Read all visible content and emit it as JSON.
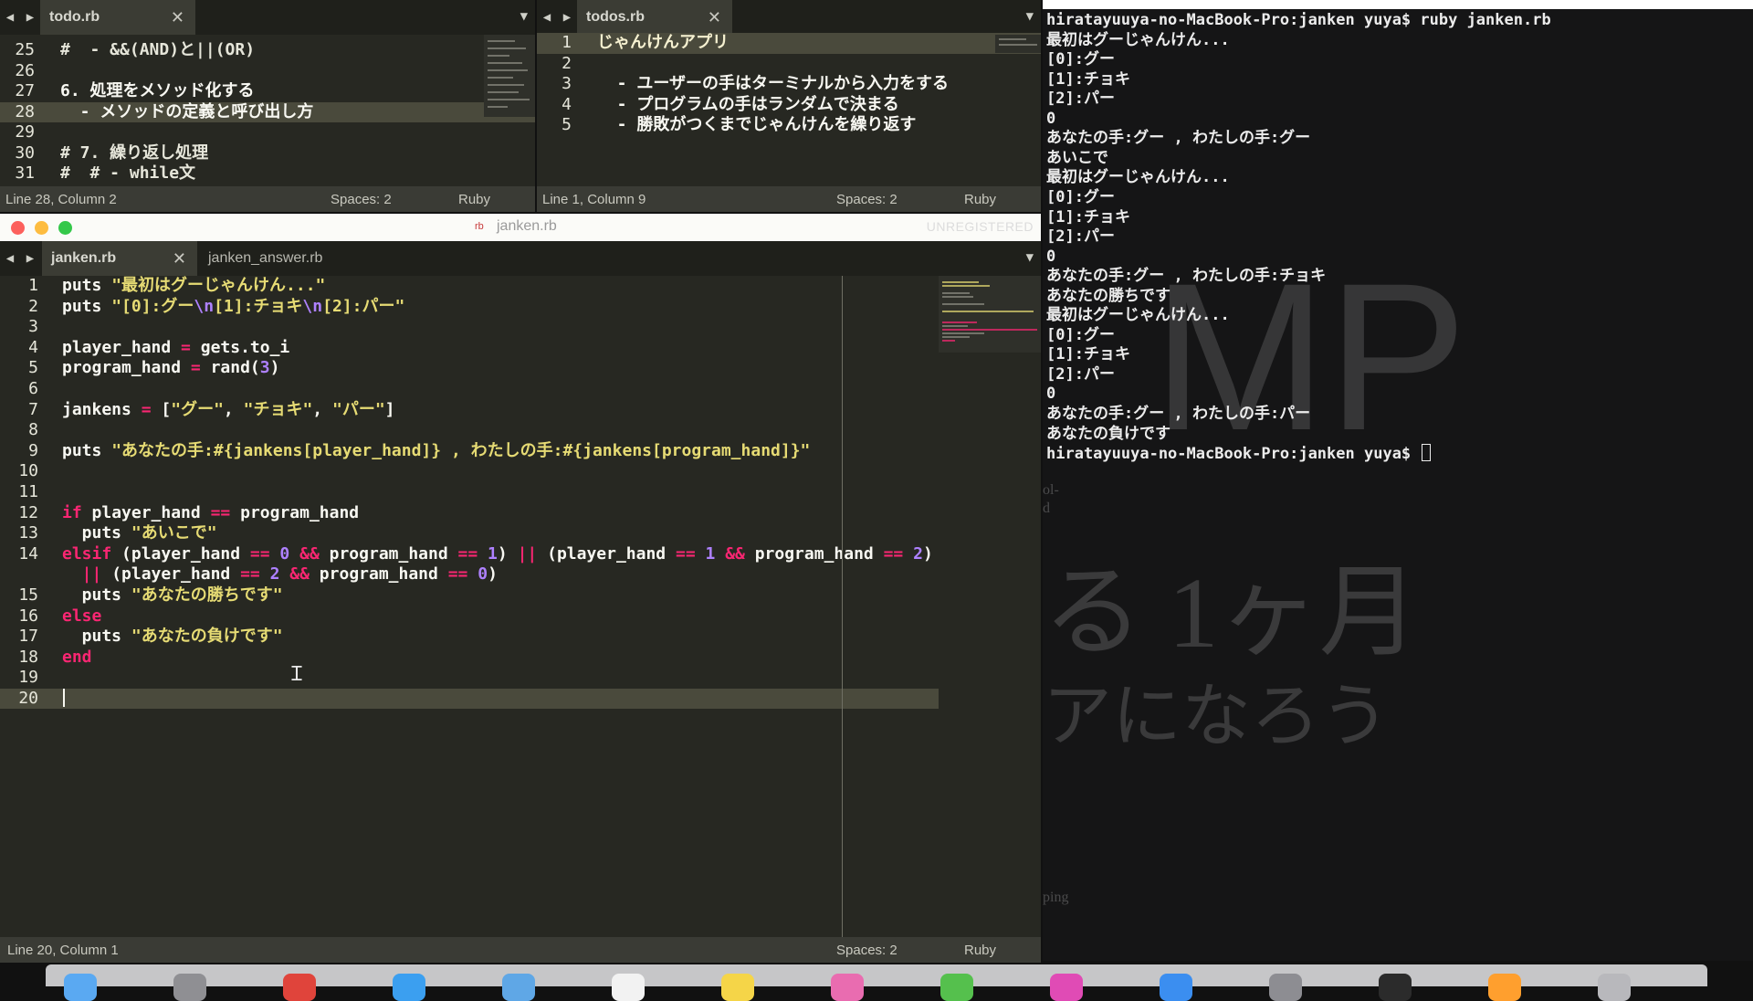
{
  "todo_pane": {
    "tab": "todo.rb",
    "status_pos": "Line 28, Column 2",
    "status_spaces": "Spaces: 2",
    "status_lang": "Ruby",
    "lines": [
      {
        "n": "25",
        "text": "#  - &&(AND)と||(OR)"
      },
      {
        "n": "26",
        "text": ""
      },
      {
        "n": "27",
        "text": "6. 処理をメソッド化する"
      },
      {
        "n": "28",
        "text": "  - メソッドの定義と呼び出し方"
      },
      {
        "n": "29",
        "text": ""
      },
      {
        "n": "30",
        "text": "# 7. 繰り返し処理"
      },
      {
        "n": "31",
        "text": "#  # - while文"
      }
    ]
  },
  "todos_pane": {
    "tab": "todos.rb",
    "status_pos": "Line 1, Column 9",
    "status_spaces": "Spaces: 2",
    "status_lang": "Ruby",
    "lines": [
      {
        "n": "1",
        "text": "じゃんけんアプリ"
      },
      {
        "n": "2",
        "text": ""
      },
      {
        "n": "3",
        "text": "  - ユーザーの手はターミナルから入力をする"
      },
      {
        "n": "4",
        "text": "  - プログラムの手はランダムで決まる"
      },
      {
        "n": "5",
        "text": "  - 勝敗がつくまでじゃんけんを繰り返す"
      }
    ]
  },
  "janken_window": {
    "title": "janken.rb",
    "unregistered": "UNREGISTERED",
    "tab_active": "janken.rb",
    "tab_other": "janken_answer.rb",
    "status_pos": "Line 20, Column 1",
    "status_spaces": "Spaces: 2",
    "status_lang": "Ruby",
    "line_numbers": [
      "1",
      "2",
      "3",
      "4",
      "5",
      "6",
      "7",
      "8",
      "9",
      "10",
      "11",
      "12",
      "13",
      "14",
      "",
      "15",
      "16",
      "17",
      "18",
      "19",
      "20"
    ],
    "code": {
      "l1_kw": "puts ",
      "l1_str": "\"最初はグーじゃんけん...\"",
      "l2_kw": "puts ",
      "l2_str_a": "\"[0]:グー",
      "l2_esc_a": "\\n",
      "l2_str_b": "[1]:チョキ",
      "l2_esc_b": "\\n",
      "l2_str_c": "[2]:パー\"",
      "l4_a": "player_hand ",
      "l4_op": "=",
      "l4_b": " gets.to_i",
      "l5_a": "program_hand ",
      "l5_op": "=",
      "l5_b": " rand(",
      "l5_num": "3",
      "l5_c": ")",
      "l7_a": "jankens ",
      "l7_op": "=",
      "l7_b": " [",
      "l7_s1": "\"グー\"",
      "l7_c1": ", ",
      "l7_s2": "\"チョキ\"",
      "l7_c2": ", ",
      "l7_s3": "\"パー\"",
      "l7_end": "]",
      "l9_kw": "puts ",
      "l9_str": "\"あなたの手:#{jankens[player_hand]} , わたしの手:#{jankens[program_hand]}\"",
      "l12_if": "if",
      "l12_a": " player_hand ",
      "l12_op": "==",
      "l12_b": " program_hand",
      "l13_kw": "  puts ",
      "l13_str": "\"あいこで\"",
      "l14_elsif": "elsif",
      "l14_a": " (player_hand ",
      "l14_eq1": "==",
      "l14_n1": " 0 ",
      "l14_and1": "&&",
      "l14_b": " program_hand ",
      "l14_eq2": "==",
      "l14_n2": " 1",
      "l14_c": ") ",
      "l14_or1": "||",
      "l14_d": " (player_hand ",
      "l14_eq3": "==",
      "l14_n3": " 1 ",
      "l14_and2": "&&",
      "l14_e": " program_hand ",
      "l14_eq4": "==",
      "l14_n4": " 2",
      "l14_f": ")",
      "l14w_or": "  ||",
      "l14w_a": " (player_hand ",
      "l14w_eq1": "==",
      "l14w_n1": " 2 ",
      "l14w_and": "&&",
      "l14w_b": " program_hand ",
      "l14w_eq2": "==",
      "l14w_n2": " 0",
      "l14w_c": ")",
      "l15_kw": "  puts ",
      "l15_str": "\"あなたの勝ちです\"",
      "l16_else": "else",
      "l17_kw": "  puts ",
      "l17_str": "\"あなたの負けです\"",
      "l18_end": "end"
    }
  },
  "terminal": {
    "lines": [
      "hiratayuuya-no-MacBook-Pro:janken yuya$ ruby janken.rb",
      "最初はグーじゃんけん...",
      "[0]:グー",
      "[1]:チョキ",
      "[2]:パー",
      "0",
      "あなたの手:グー , わたしの手:グー",
      "あいこで",
      "最初はグーじゃんけん...",
      "[0]:グー",
      "[1]:チョキ",
      "[2]:パー",
      "0",
      "あなたの手:グー , わたしの手:チョキ",
      "あなたの勝ちです",
      "最初はグーじゃんけん...",
      "[0]:グー",
      "[1]:チョキ",
      "[2]:パー",
      "0",
      "あなたの手:グー , わたしの手:パー",
      "あなたの負けです"
    ],
    "prompt": "hiratayuuya-no-MacBook-Pro:janken yuya$ ",
    "bg_text_big": "MP",
    "bg_text_month": "る 1ヶ月",
    "bg_text_bottom": "アになろう",
    "bg_text_small_1": "ol-",
    "bg_text_small_2": "d",
    "bg_text_small_3": "ping"
  },
  "dock": {
    "icons": [
      "finder-icon",
      "launchpad-icon",
      "chrome-icon",
      "safari-icon",
      "mail-icon",
      "calendar-icon",
      "notes-icon",
      "photos-icon",
      "messages-icon",
      "itunes-icon",
      "app-store-icon",
      "preferences-icon",
      "terminal-icon",
      "sublime-icon",
      "trash-icon"
    ]
  }
}
